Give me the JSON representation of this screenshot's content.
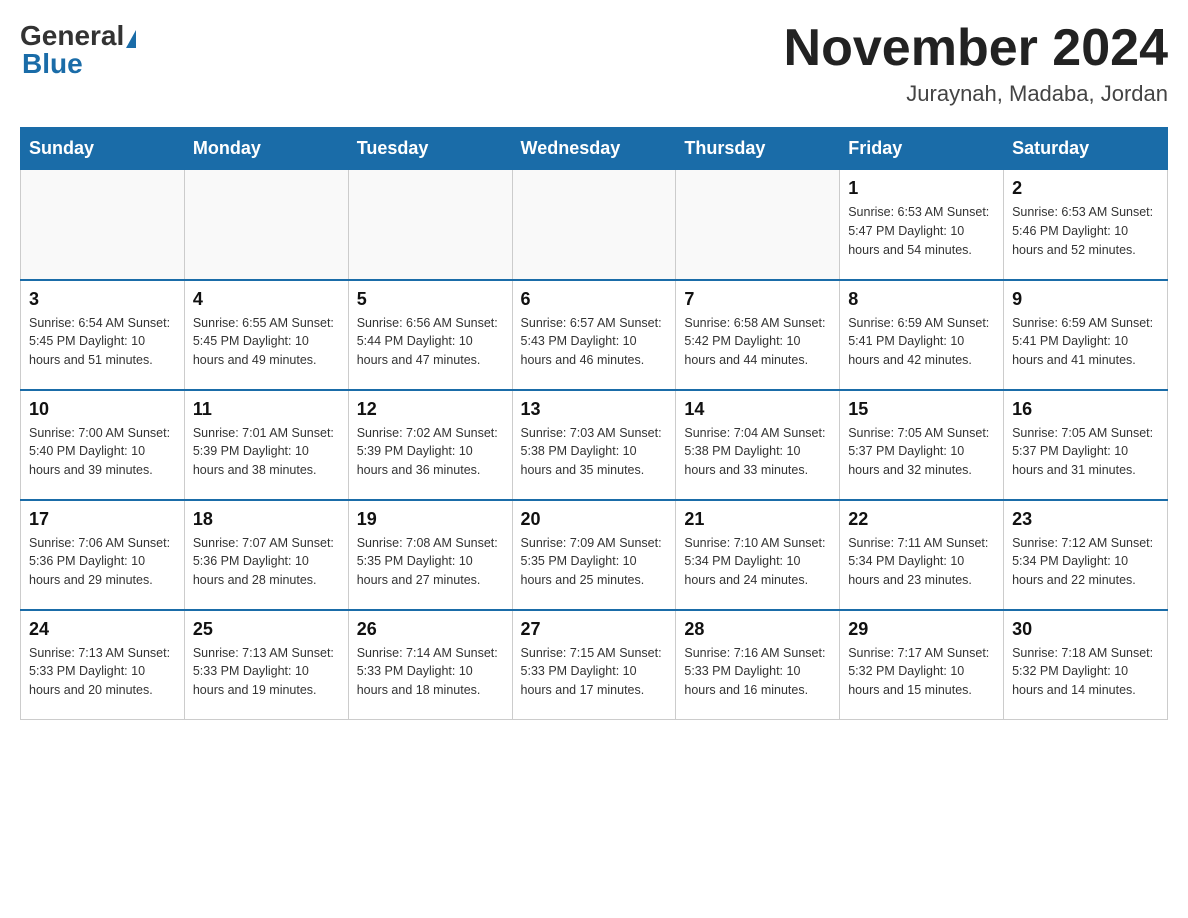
{
  "header": {
    "logo_general": "General",
    "logo_blue": "Blue",
    "month_title": "November 2024",
    "location": "Juraynah, Madaba, Jordan"
  },
  "days_of_week": [
    "Sunday",
    "Monday",
    "Tuesday",
    "Wednesday",
    "Thursday",
    "Friday",
    "Saturday"
  ],
  "weeks": [
    [
      {
        "day": "",
        "info": ""
      },
      {
        "day": "",
        "info": ""
      },
      {
        "day": "",
        "info": ""
      },
      {
        "day": "",
        "info": ""
      },
      {
        "day": "",
        "info": ""
      },
      {
        "day": "1",
        "info": "Sunrise: 6:53 AM\nSunset: 5:47 PM\nDaylight: 10 hours\nand 54 minutes."
      },
      {
        "day": "2",
        "info": "Sunrise: 6:53 AM\nSunset: 5:46 PM\nDaylight: 10 hours\nand 52 minutes."
      }
    ],
    [
      {
        "day": "3",
        "info": "Sunrise: 6:54 AM\nSunset: 5:45 PM\nDaylight: 10 hours\nand 51 minutes."
      },
      {
        "day": "4",
        "info": "Sunrise: 6:55 AM\nSunset: 5:45 PM\nDaylight: 10 hours\nand 49 minutes."
      },
      {
        "day": "5",
        "info": "Sunrise: 6:56 AM\nSunset: 5:44 PM\nDaylight: 10 hours\nand 47 minutes."
      },
      {
        "day": "6",
        "info": "Sunrise: 6:57 AM\nSunset: 5:43 PM\nDaylight: 10 hours\nand 46 minutes."
      },
      {
        "day": "7",
        "info": "Sunrise: 6:58 AM\nSunset: 5:42 PM\nDaylight: 10 hours\nand 44 minutes."
      },
      {
        "day": "8",
        "info": "Sunrise: 6:59 AM\nSunset: 5:41 PM\nDaylight: 10 hours\nand 42 minutes."
      },
      {
        "day": "9",
        "info": "Sunrise: 6:59 AM\nSunset: 5:41 PM\nDaylight: 10 hours\nand 41 minutes."
      }
    ],
    [
      {
        "day": "10",
        "info": "Sunrise: 7:00 AM\nSunset: 5:40 PM\nDaylight: 10 hours\nand 39 minutes."
      },
      {
        "day": "11",
        "info": "Sunrise: 7:01 AM\nSunset: 5:39 PM\nDaylight: 10 hours\nand 38 minutes."
      },
      {
        "day": "12",
        "info": "Sunrise: 7:02 AM\nSunset: 5:39 PM\nDaylight: 10 hours\nand 36 minutes."
      },
      {
        "day": "13",
        "info": "Sunrise: 7:03 AM\nSunset: 5:38 PM\nDaylight: 10 hours\nand 35 minutes."
      },
      {
        "day": "14",
        "info": "Sunrise: 7:04 AM\nSunset: 5:38 PM\nDaylight: 10 hours\nand 33 minutes."
      },
      {
        "day": "15",
        "info": "Sunrise: 7:05 AM\nSunset: 5:37 PM\nDaylight: 10 hours\nand 32 minutes."
      },
      {
        "day": "16",
        "info": "Sunrise: 7:05 AM\nSunset: 5:37 PM\nDaylight: 10 hours\nand 31 minutes."
      }
    ],
    [
      {
        "day": "17",
        "info": "Sunrise: 7:06 AM\nSunset: 5:36 PM\nDaylight: 10 hours\nand 29 minutes."
      },
      {
        "day": "18",
        "info": "Sunrise: 7:07 AM\nSunset: 5:36 PM\nDaylight: 10 hours\nand 28 minutes."
      },
      {
        "day": "19",
        "info": "Sunrise: 7:08 AM\nSunset: 5:35 PM\nDaylight: 10 hours\nand 27 minutes."
      },
      {
        "day": "20",
        "info": "Sunrise: 7:09 AM\nSunset: 5:35 PM\nDaylight: 10 hours\nand 25 minutes."
      },
      {
        "day": "21",
        "info": "Sunrise: 7:10 AM\nSunset: 5:34 PM\nDaylight: 10 hours\nand 24 minutes."
      },
      {
        "day": "22",
        "info": "Sunrise: 7:11 AM\nSunset: 5:34 PM\nDaylight: 10 hours\nand 23 minutes."
      },
      {
        "day": "23",
        "info": "Sunrise: 7:12 AM\nSunset: 5:34 PM\nDaylight: 10 hours\nand 22 minutes."
      }
    ],
    [
      {
        "day": "24",
        "info": "Sunrise: 7:13 AM\nSunset: 5:33 PM\nDaylight: 10 hours\nand 20 minutes."
      },
      {
        "day": "25",
        "info": "Sunrise: 7:13 AM\nSunset: 5:33 PM\nDaylight: 10 hours\nand 19 minutes."
      },
      {
        "day": "26",
        "info": "Sunrise: 7:14 AM\nSunset: 5:33 PM\nDaylight: 10 hours\nand 18 minutes."
      },
      {
        "day": "27",
        "info": "Sunrise: 7:15 AM\nSunset: 5:33 PM\nDaylight: 10 hours\nand 17 minutes."
      },
      {
        "day": "28",
        "info": "Sunrise: 7:16 AM\nSunset: 5:33 PM\nDaylight: 10 hours\nand 16 minutes."
      },
      {
        "day": "29",
        "info": "Sunrise: 7:17 AM\nSunset: 5:32 PM\nDaylight: 10 hours\nand 15 minutes."
      },
      {
        "day": "30",
        "info": "Sunrise: 7:18 AM\nSunset: 5:32 PM\nDaylight: 10 hours\nand 14 minutes."
      }
    ]
  ]
}
